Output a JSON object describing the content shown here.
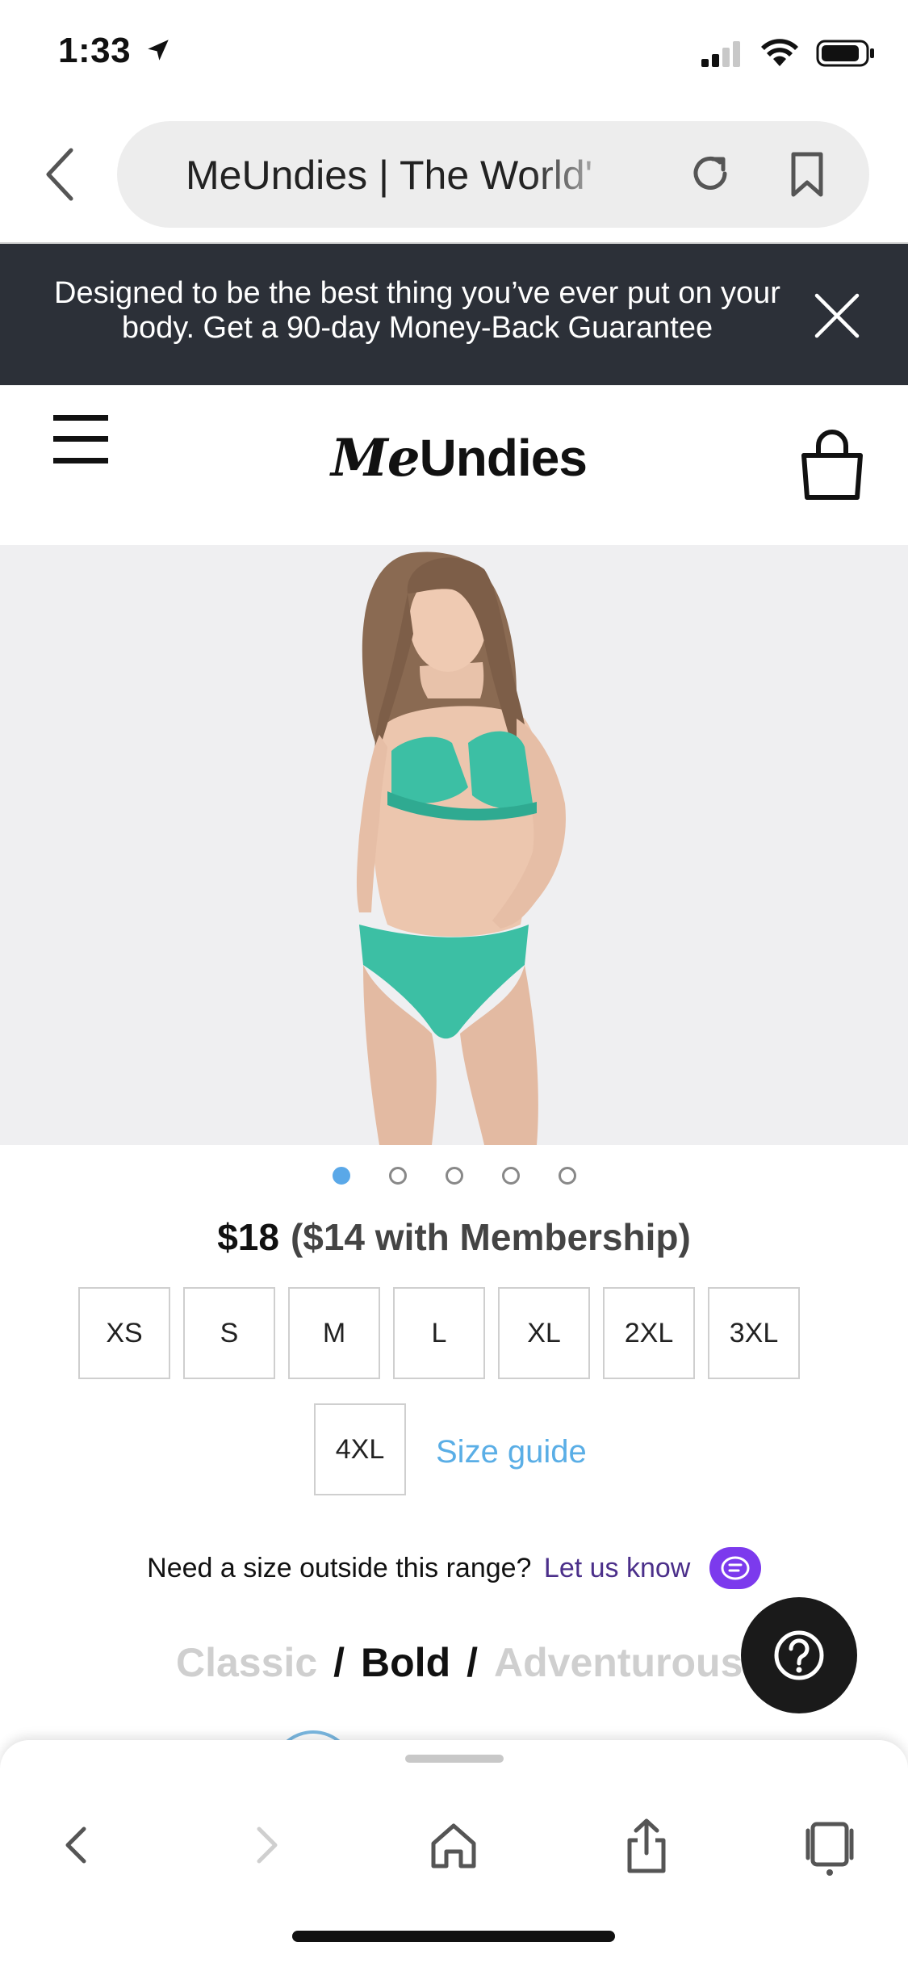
{
  "status_bar": {
    "time": "1:33"
  },
  "url_bar": {
    "title": "MeUndies | The World'"
  },
  "banner": {
    "text": "Designed to be the best thing you’ve ever put on your body. Get a 90-day Money-Back Guarantee"
  },
  "header": {
    "logo": "MeUndies",
    "logo_me": "Me",
    "logo_rest": "Undies"
  },
  "carousel": {
    "total": 5,
    "active_index": 0
  },
  "pricing": {
    "price": "$18",
    "member_price": "($14 with Membership)"
  },
  "sizes": [
    "XS",
    "S",
    "M",
    "L",
    "XL",
    "2XL",
    "3XL"
  ],
  "size_extra": "4XL",
  "size_guide": "Size guide",
  "need_size": {
    "text": "Need a size outside this range?",
    "link": "Let us know"
  },
  "styles": {
    "classic": "Classic",
    "bold": "Bold",
    "adventurous": "Adventurous",
    "separator": "/"
  },
  "colors": {
    "banner_bg": "#2c3038",
    "accent_blue": "#5aa8e8",
    "chat_purple": "#7c3aed",
    "swimsuit": "#3cbfa4"
  }
}
